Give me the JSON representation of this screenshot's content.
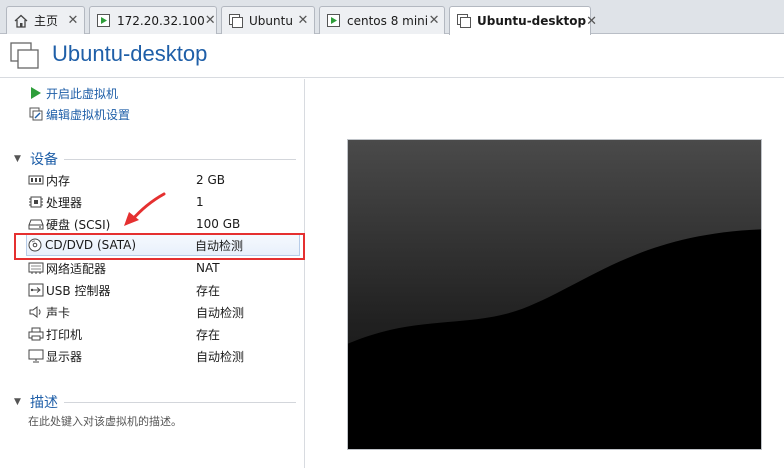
{
  "tabs": [
    {
      "label": "主页",
      "icon": "home-icon",
      "active": false
    },
    {
      "label": "172.20.32.100",
      "icon": "vm-running-icon",
      "active": false
    },
    {
      "label": "Ubuntu",
      "icon": "vm-icon",
      "active": false
    },
    {
      "label": "centos 8 mini",
      "icon": "vm-running-icon",
      "active": false
    },
    {
      "label": "Ubuntu-desktop",
      "icon": "vm-icon",
      "active": true
    }
  ],
  "tab_close_glyph": "✕",
  "vm": {
    "title": "Ubuntu-desktop"
  },
  "actions": [
    {
      "label": "开启此虚拟机",
      "icon": "play-icon"
    },
    {
      "label": "编辑虚拟机设置",
      "icon": "edit-settings-icon"
    }
  ],
  "devices_section": {
    "title": "设备",
    "toggle": "▼"
  },
  "devices": [
    {
      "name": "内存",
      "value": "2 GB",
      "icon": "memory-icon"
    },
    {
      "name": "处理器",
      "value": "1",
      "icon": "cpu-icon"
    },
    {
      "name": "硬盘 (SCSI)",
      "value": "100 GB",
      "icon": "hard-disk-icon"
    },
    {
      "name": "CD/DVD (SATA)",
      "value": "自动检测",
      "icon": "cd-dvd-icon",
      "selected": true
    },
    {
      "name": "网络适配器",
      "value": "NAT",
      "icon": "network-adapter-icon"
    },
    {
      "name": "USB 控制器",
      "value": "存在",
      "icon": "usb-icon"
    },
    {
      "name": "声卡",
      "value": "自动检测",
      "icon": "speaker-icon"
    },
    {
      "name": "打印机",
      "value": "存在",
      "icon": "printer-icon"
    },
    {
      "name": "显示器",
      "value": "自动检测",
      "icon": "monitor-icon"
    }
  ],
  "description_section": {
    "title": "描述",
    "toggle": "▼",
    "placeholder": "在此处键入对该虚拟机的描述。"
  },
  "colors": {
    "accent": "#1f5fa8",
    "annotation": "#e53030",
    "play": "#2e9e3a"
  }
}
